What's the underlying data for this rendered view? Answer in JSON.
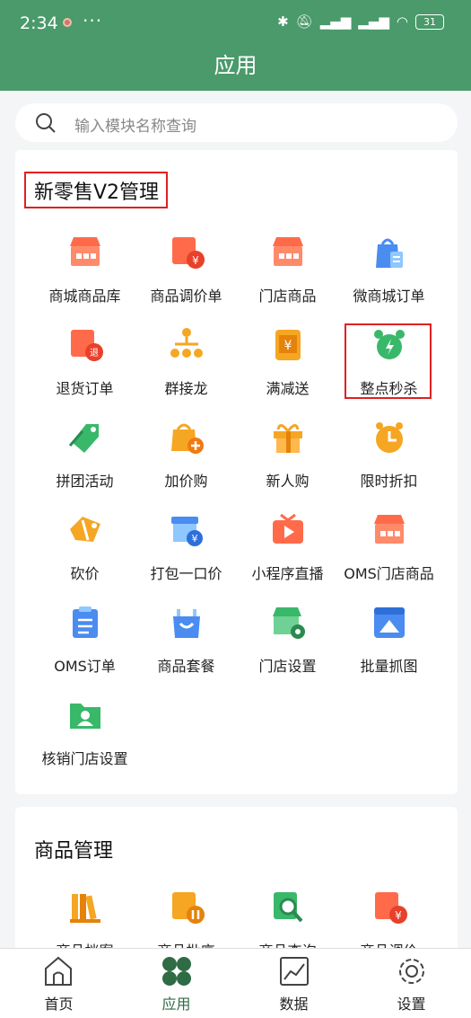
{
  "status_bar": {
    "time": "2:34",
    "more": "···",
    "battery": "31"
  },
  "header": {
    "title": "应用"
  },
  "search": {
    "placeholder": "输入模块名称查询"
  },
  "sections": [
    {
      "title": "新零售V2管理",
      "items": [
        {
          "label": "商城商品库",
          "icon": "store-icon"
        },
        {
          "label": "商品调价单",
          "icon": "price-adjust-icon"
        },
        {
          "label": "门店商品",
          "icon": "shop-icon"
        },
        {
          "label": "微商城订单",
          "icon": "shopping-bag-icon"
        },
        {
          "label": "退货订单",
          "icon": "return-order-icon"
        },
        {
          "label": "群接龙",
          "icon": "org-chart-icon"
        },
        {
          "label": "满减送",
          "icon": "coupon-icon"
        },
        {
          "label": "整点秒杀",
          "icon": "alarm-clock-icon"
        },
        {
          "label": "拼团活动",
          "icon": "tag-icon"
        },
        {
          "label": "加价购",
          "icon": "bag-plus-icon"
        },
        {
          "label": "新人购",
          "icon": "gift-icon"
        },
        {
          "label": "限时折扣",
          "icon": "clock-icon"
        },
        {
          "label": "砍价",
          "icon": "cut-tag-icon"
        },
        {
          "label": "打包一口价",
          "icon": "package-price-icon"
        },
        {
          "label": "小程序直播",
          "icon": "tv-play-icon"
        },
        {
          "label": "OMS门店商品",
          "icon": "oms-store-icon"
        },
        {
          "label": "OMS订单",
          "icon": "clipboard-icon"
        },
        {
          "label": "商品套餐",
          "icon": "bundle-bag-icon"
        },
        {
          "label": "门店设置",
          "icon": "store-settings-icon"
        },
        {
          "label": "批量抓图",
          "icon": "image-grab-icon"
        },
        {
          "label": "核销门店设置",
          "icon": "user-folder-icon"
        }
      ]
    },
    {
      "title": "商品管理",
      "items": [
        {
          "label": "商品档案",
          "icon": "books-icon"
        },
        {
          "label": "商品批序",
          "icon": "box-sort-icon"
        },
        {
          "label": "商品查询",
          "icon": "search-doc-icon"
        },
        {
          "label": "商品调价",
          "icon": "price-adjust-icon"
        }
      ]
    }
  ],
  "tabbar": [
    {
      "label": "首页",
      "icon": "home-icon"
    },
    {
      "label": "应用",
      "icon": "apps-clover-icon",
      "active": true
    },
    {
      "label": "数据",
      "icon": "chart-icon"
    },
    {
      "label": "设置",
      "icon": "gear-icon"
    }
  ],
  "colors": {
    "primary": "#4a9a6b",
    "highlight_border": "#e02020"
  }
}
